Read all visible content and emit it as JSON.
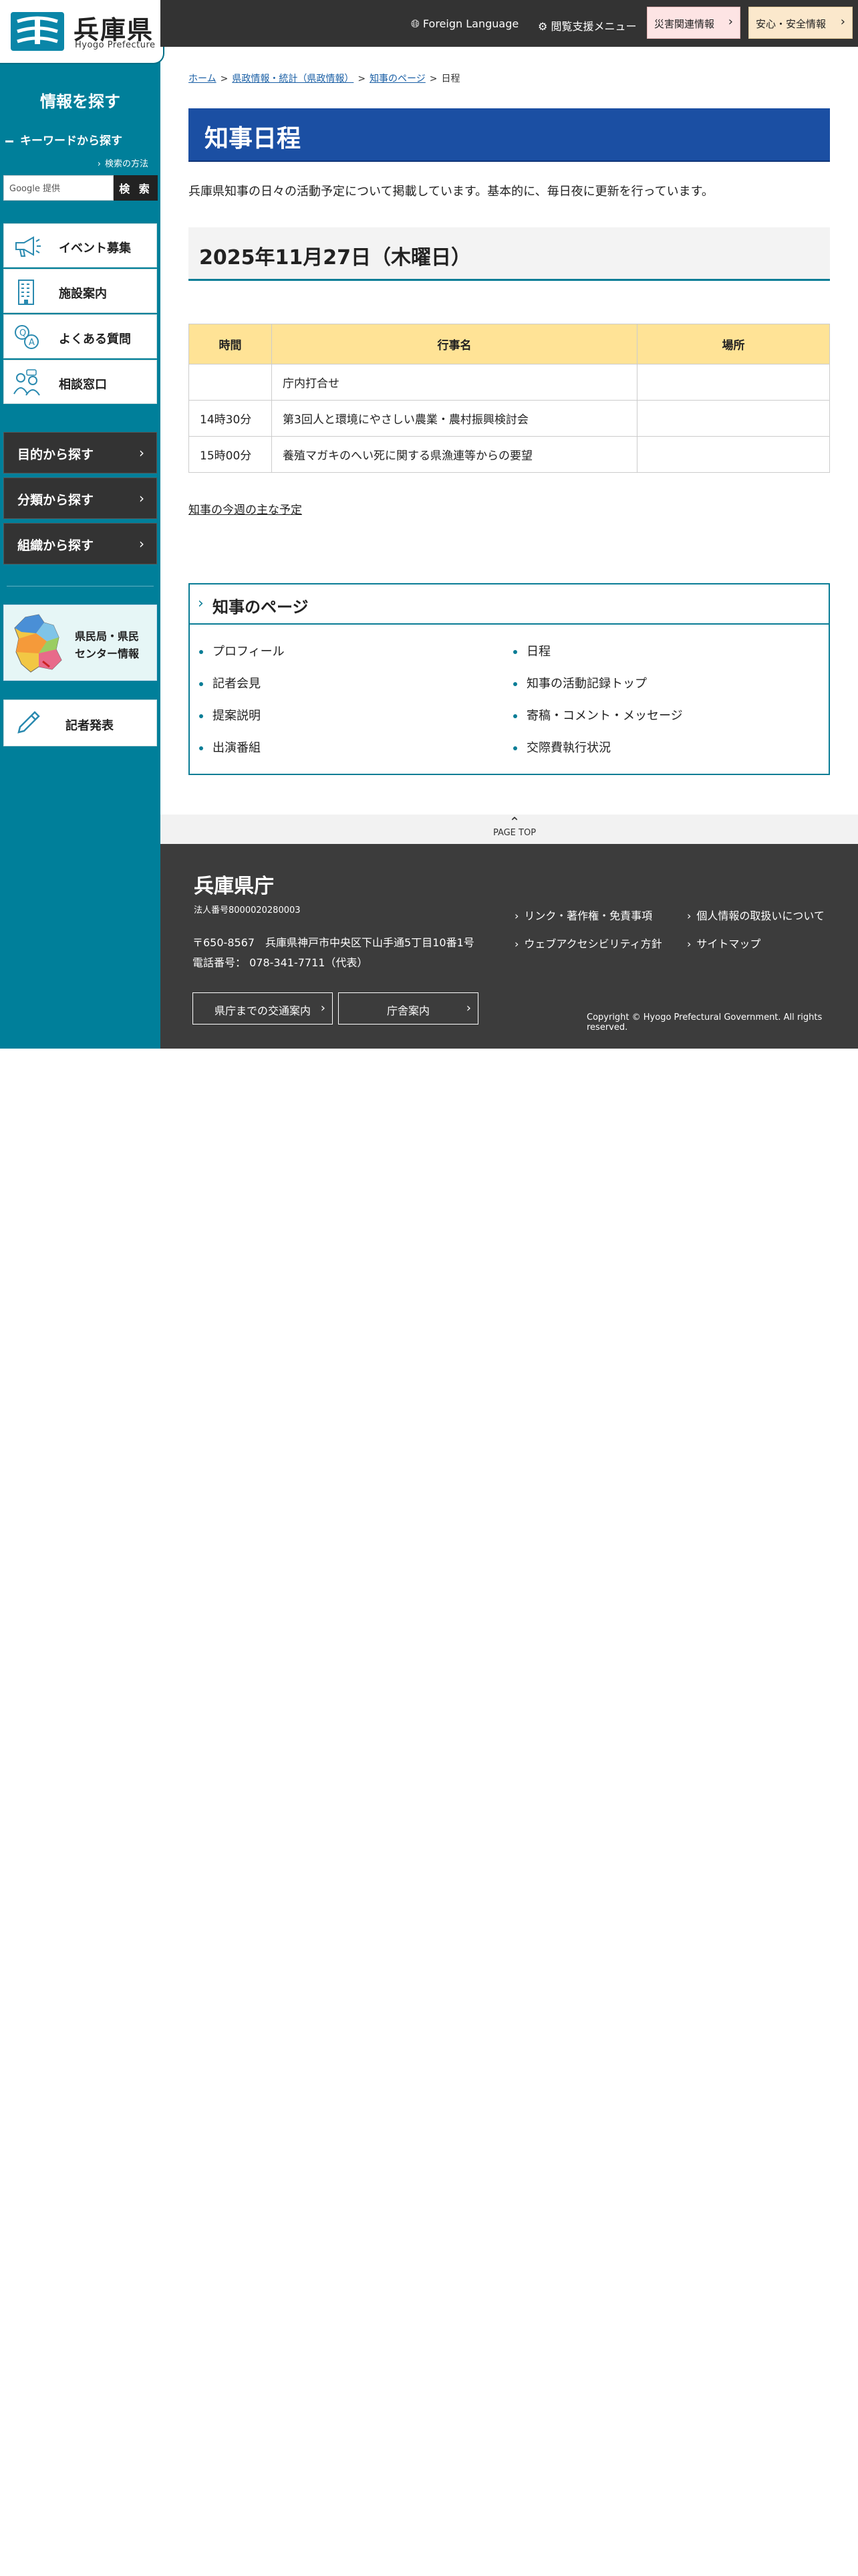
{
  "sidebar": {
    "logo": {
      "title": "兵庫県",
      "subtitle": "Hyogo Prefecture"
    },
    "search_title": "情報を探す",
    "keyword_label": "キーワードから探す",
    "search_help": "検索の方法",
    "search_placeholder": "Google 提供",
    "search_button": "検 索",
    "links": [
      {
        "label": "イベント募集",
        "icon": "megaphone-icon"
      },
      {
        "label": "施設案内",
        "icon": "building-icon"
      },
      {
        "label": "よくある質問",
        "icon": "qa-icon"
      },
      {
        "label": "相談窓口",
        "icon": "consultation-icon"
      }
    ],
    "categories": [
      {
        "label": "目的から探す"
      },
      {
        "label": "分類から探す"
      },
      {
        "label": "組織から探す"
      }
    ],
    "center_banner": {
      "line1": "県民局・県民",
      "line2": "センター情報"
    },
    "press": "記者発表"
  },
  "header": {
    "foreign_language": "Foreign Language",
    "assist_menu": "閲覧支援メニュー",
    "disaster": "災害関連情報",
    "safety": "安心・安全情報"
  },
  "breadcrumb": {
    "home": "ホーム",
    "stats": "県政情報・統計（県政情報）",
    "governor": "知事のページ",
    "current": "日程"
  },
  "page": {
    "title": "知事日程",
    "intro": "兵庫県知事の日々の活動予定について掲載しています。基本的に、毎日夜に更新を行っています。",
    "date_heading": "2025年11月27日（木曜日）"
  },
  "schedule": {
    "headers": [
      "時間",
      "行事名",
      "場所"
    ],
    "rows": [
      {
        "time": "",
        "event": "庁内打合せ",
        "place": ""
      },
      {
        "time": "14時30分",
        "event": "第3回人と環境にやさしい農業・農村振興検討会",
        "place": ""
      },
      {
        "time": "15時00分",
        "event": "養殖マガキのへい死に関する県漁連等からの要望",
        "place": ""
      }
    ]
  },
  "weekly_link": "知事の今週の主な予定",
  "governor_box": {
    "title": "知事のページ",
    "items": [
      "プロフィール",
      "日程",
      "記者会見",
      "知事の活動記録トップ",
      "提案説明",
      "寄稿・コメント・メッセージ",
      "出演番組",
      "交際費執行状況"
    ]
  },
  "page_top": "PAGE TOP",
  "footer": {
    "title": "兵庫県庁",
    "corp_number": "法人番号8000020280003",
    "address": "〒650-8567　兵庫県神戸市中央区下山手通5丁目10番1号",
    "phone": "電話番号：  078-341-7711（代表）",
    "buttons": [
      "県庁までの交通案内",
      "庁舎案内"
    ],
    "links": [
      "リンク・著作権・免責事項",
      "個人情報の取扱いについて",
      "ウェブアクセシビリティ方針",
      "サイトマップ"
    ],
    "copyright": "Copyright © Hyogo Prefectural Government. All rights reserved."
  }
}
